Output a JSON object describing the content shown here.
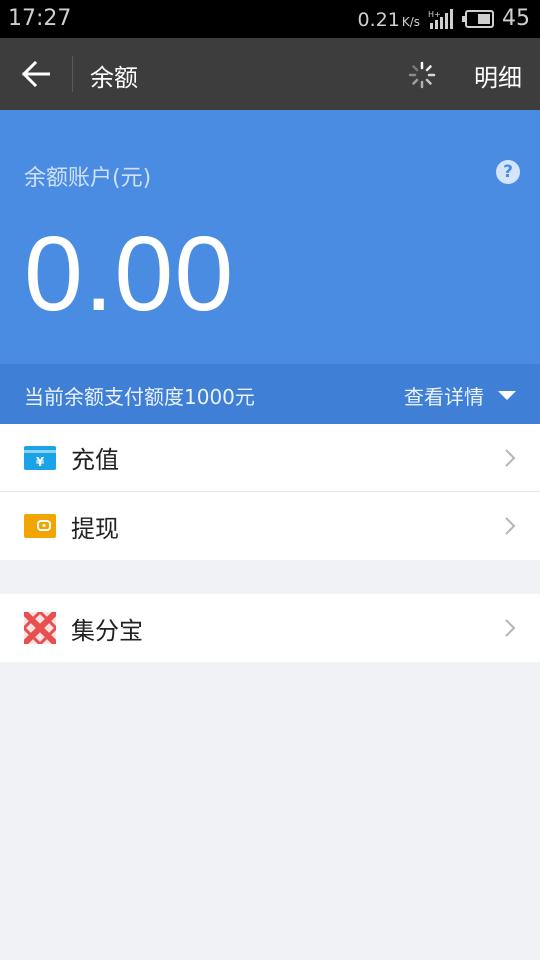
{
  "status_bar": {
    "time": "17:27",
    "net_speed": "0.21",
    "net_unit": "K/s",
    "battery": "45"
  },
  "appbar": {
    "title": "余额",
    "detail_label": "明细"
  },
  "balance": {
    "label": "余额账户(元)",
    "amount": "0.00",
    "help": "?"
  },
  "limit": {
    "text": "当前余额支付额度1000元",
    "view_details_label": "查看详情"
  },
  "menu": {
    "recharge_label": "充值",
    "recharge_symbol": "¥",
    "withdraw_label": "提现",
    "points_label": "集分宝"
  },
  "colors": {
    "status_bg": "#000000",
    "appbar_bg": "#3d3d3d",
    "balance_bg": "#4b8ce3",
    "limit_bg": "#3f7fd6",
    "page_bg": "#f1f2f6",
    "recharge_icon": "#1aa3e6",
    "withdraw_icon": "#f2a400",
    "points_icon": "#e8504f"
  }
}
